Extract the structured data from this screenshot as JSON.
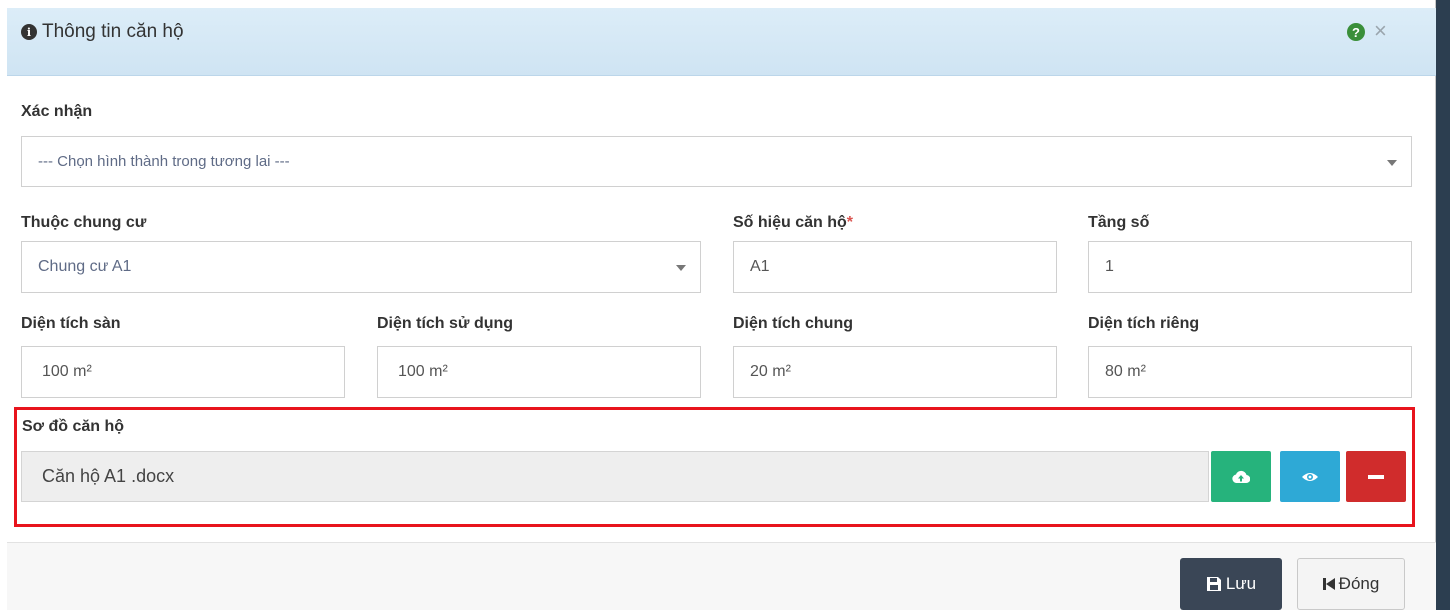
{
  "header": {
    "title": "Thông tin căn hộ",
    "icons": {
      "info": "info-circle-icon",
      "help": "question-circle-icon",
      "close": "close-icon"
    }
  },
  "confirm": {
    "label": "Xác nhận",
    "select_value": "--- Chọn hình thành trong tương lai ---"
  },
  "building": {
    "label": "Thuộc chung cư",
    "select_value": "Chung cư A1"
  },
  "apartment_number": {
    "label": "Số hiệu căn hộ",
    "required_mark": "*",
    "value": "A1"
  },
  "floor": {
    "label": "Tầng số",
    "value": "1"
  },
  "areas": [
    {
      "label": "Diện tích sàn",
      "value": "100 m²"
    },
    {
      "label": "Diện tích sử dụng",
      "value": "100 m²"
    },
    {
      "label": "Diện tích chung",
      "value": "20 m²"
    },
    {
      "label": "Diện tích riêng",
      "value": "80 m²"
    }
  ],
  "floor_plan": {
    "label": "Sơ đồ căn hộ",
    "file_name": "Căn hộ A1 .docx",
    "icons": {
      "upload": "cloud-upload-icon",
      "view": "eye-icon",
      "remove": "minus-icon"
    }
  },
  "footer": {
    "save_label": "Lưu",
    "close_label": "Đóng",
    "icons": {
      "save": "save-icon",
      "close": "step-backward-icon"
    }
  },
  "colors": {
    "header_bg": "#d8eaf6",
    "upload_btn": "#26b37c",
    "view_btn": "#2ea9d6",
    "remove_btn": "#d02c2c",
    "save_btn": "#3a4656",
    "highlight_border": "#e8141d",
    "required": "#d9534f"
  }
}
